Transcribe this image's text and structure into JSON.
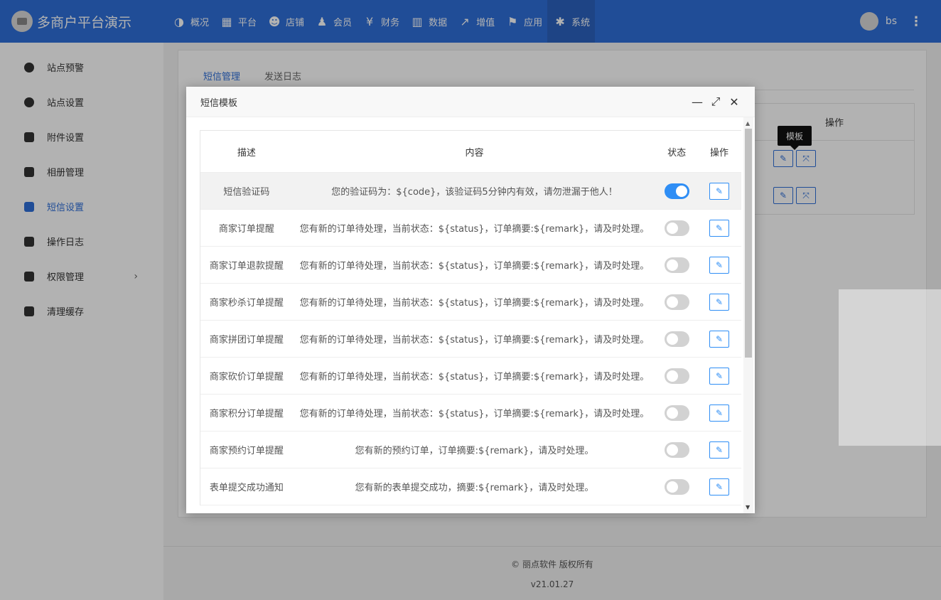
{
  "colors": {
    "primary": "#2f6fd8",
    "toggle_on": "#2f8ef5"
  },
  "header": {
    "brand": "多商户平台演示",
    "nav": [
      {
        "label": "概况",
        "icon": "dashboard-icon",
        "glyph": "◑"
      },
      {
        "label": "平台",
        "icon": "grid-icon",
        "glyph": "▦"
      },
      {
        "label": "店铺",
        "icon": "users-icon",
        "glyph": "☻"
      },
      {
        "label": "会员",
        "icon": "user-add-icon",
        "glyph": "♟"
      },
      {
        "label": "财务",
        "icon": "yen-icon",
        "glyph": "¥"
      },
      {
        "label": "数据",
        "icon": "bar-chart-icon",
        "glyph": "▥"
      },
      {
        "label": "增值",
        "icon": "line-chart-icon",
        "glyph": "↗"
      },
      {
        "label": "应用",
        "icon": "flag-icon",
        "glyph": "⚑"
      },
      {
        "label": "系统",
        "icon": "gear-icon",
        "glyph": "✱"
      }
    ],
    "user": "bs",
    "more": "⋮"
  },
  "sidebar": {
    "items": [
      {
        "label": "站点预警",
        "icon": "circle-gear-icon"
      },
      {
        "label": "站点设置",
        "icon": "circle-gear-icon"
      },
      {
        "label": "附件设置",
        "icon": "folder-icon"
      },
      {
        "label": "相册管理",
        "icon": "folder-icon"
      },
      {
        "label": "短信设置",
        "icon": "message-icon"
      },
      {
        "label": "操作日志",
        "icon": "document-icon"
      },
      {
        "label": "权限管理",
        "icon": "user-card-icon"
      },
      {
        "label": "清理缓存",
        "icon": "document-icon"
      }
    ],
    "chevron": "›"
  },
  "main": {
    "tabs": [
      "短信管理",
      "发送日志"
    ],
    "bg_table_header": "操作",
    "tooltip": "模板"
  },
  "footer": {
    "copyright": "© 丽点软件 版权所有",
    "version": "v21.01.27"
  },
  "modal": {
    "title": "短信模板",
    "controls": {
      "minimize": "—",
      "maximize": "⤢",
      "close": "✕"
    },
    "columns": [
      "描述",
      "内容",
      "状态",
      "操作"
    ],
    "rows": [
      {
        "desc": "短信验证码",
        "content": "您的验证码为：${code}，该验证码5分钟内有效，请勿泄漏于他人！",
        "enabled": true
      },
      {
        "desc": "商家订单提醒",
        "content": "您有新的订单待处理，当前状态：${status}，订单摘要:${remark}，请及时处理。",
        "enabled": false
      },
      {
        "desc": "商家订单退款提醒",
        "content": "您有新的订单待处理，当前状态：${status}，订单摘要:${remark}，请及时处理。",
        "enabled": false
      },
      {
        "desc": "商家秒杀订单提醒",
        "content": "您有新的订单待处理，当前状态：${status}，订单摘要:${remark}，请及时处理。",
        "enabled": false
      },
      {
        "desc": "商家拼团订单提醒",
        "content": "您有新的订单待处理，当前状态：${status}，订单摘要:${remark}，请及时处理。",
        "enabled": false
      },
      {
        "desc": "商家砍价订单提醒",
        "content": "您有新的订单待处理，当前状态：${status}，订单摘要:${remark}，请及时处理。",
        "enabled": false
      },
      {
        "desc": "商家积分订单提醒",
        "content": "您有新的订单待处理，当前状态：${status}，订单摘要:${remark}，请及时处理。",
        "enabled": false
      },
      {
        "desc": "商家预约订单提醒",
        "content": "您有新的预约订单，订单摘要:${remark}，请及时处理。",
        "enabled": false
      },
      {
        "desc": "表单提交成功通知",
        "content": "您有新的表单提交成功，摘要:${remark}，请及时处理。",
        "enabled": false
      }
    ]
  }
}
